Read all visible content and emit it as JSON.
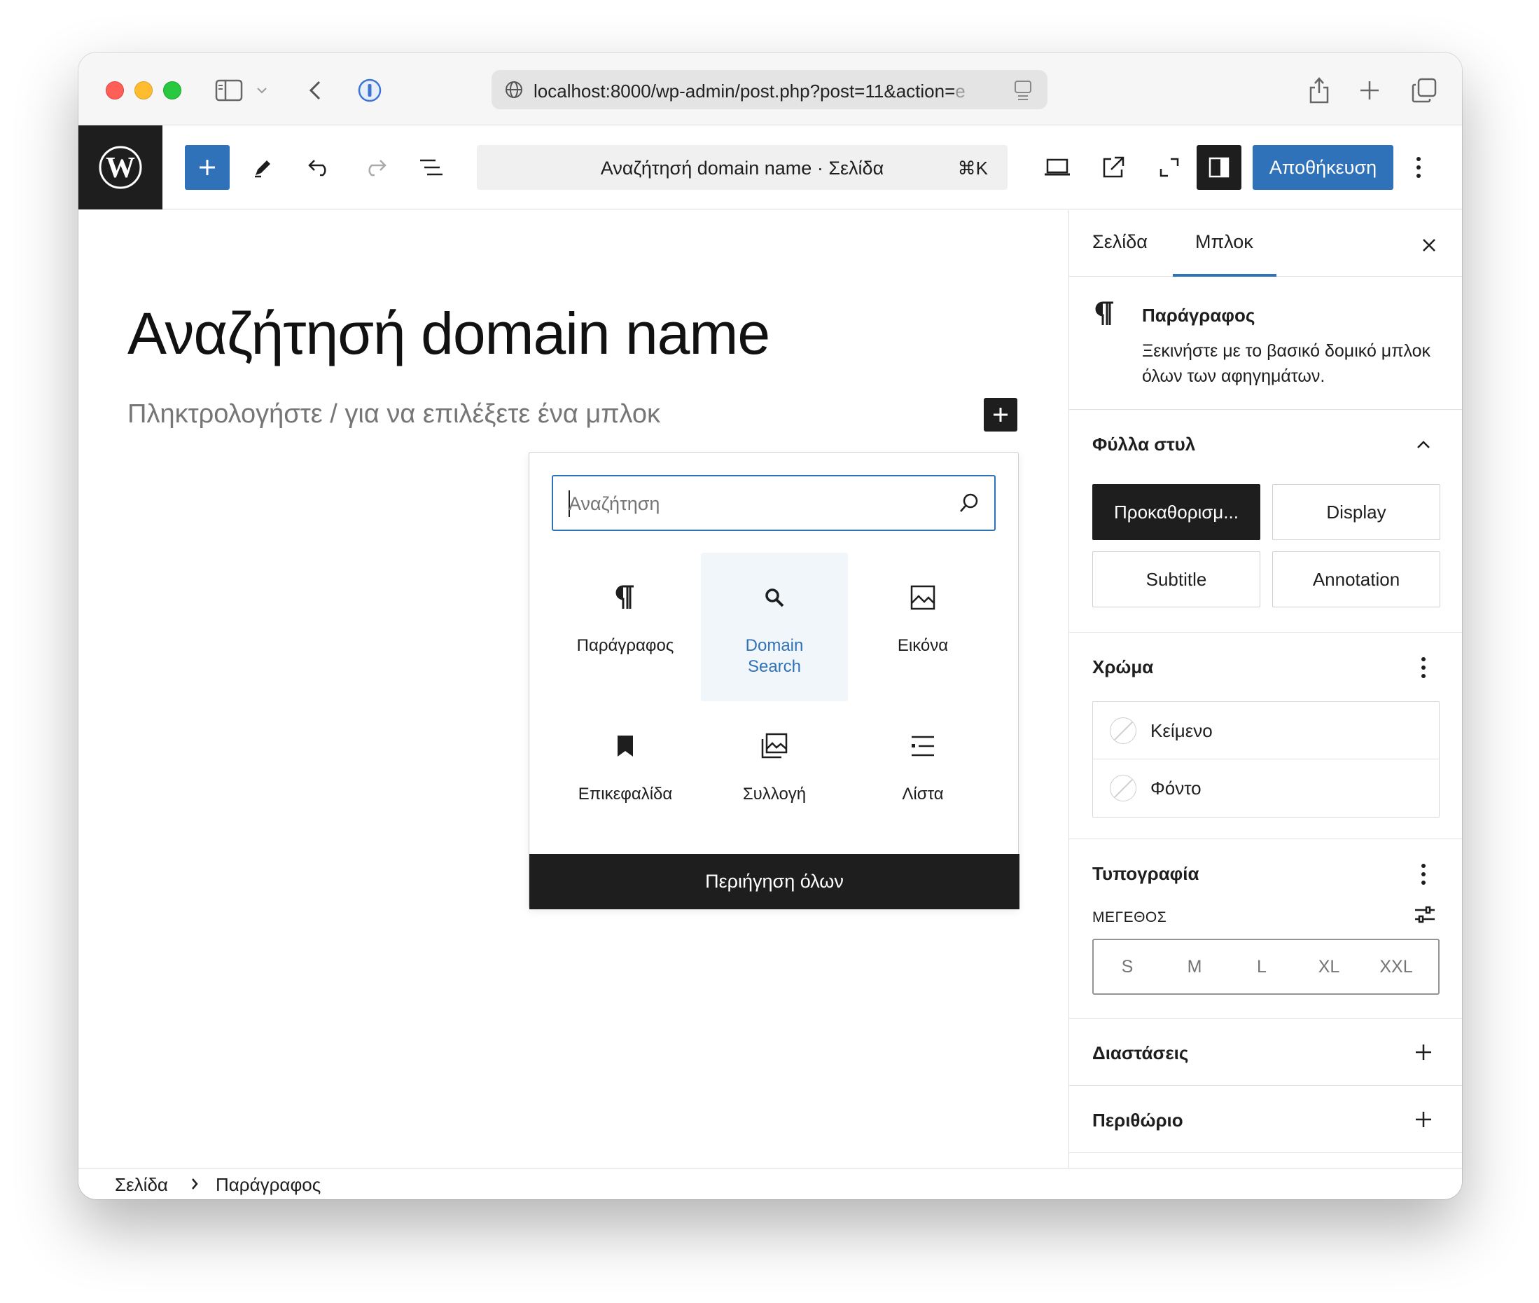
{
  "browser": {
    "url": "localhost:8000/wp-admin/post.php?post=11&action=e",
    "url_visible": "localhost:8000/wp-admin/post.php?post=11&action=",
    "url_faded_tail": "e"
  },
  "toolbar": {
    "document_title": "Αναζήτησή domain name · Σελίδα",
    "shortcut": "⌘K",
    "save_label": "Αποθήκευση"
  },
  "editor": {
    "post_title": "Αναζήτησή domain name",
    "block_placeholder": "Πληκτρολογήστε / για να επιλέξετε ένα μπλοκ"
  },
  "inserter": {
    "search_placeholder": "Αναζήτηση",
    "blocks": [
      {
        "label": "Παράγραφος",
        "icon": "paragraph-icon"
      },
      {
        "label": "Domain Search",
        "icon": "search-icon"
      },
      {
        "label": "Εικόνα",
        "icon": "image-icon"
      },
      {
        "label": "Επικεφαλίδα",
        "icon": "bookmark-icon"
      },
      {
        "label": "Συλλογή",
        "icon": "gallery-icon"
      },
      {
        "label": "Λίστα",
        "icon": "list-icon"
      }
    ],
    "browse_all": "Περιήγηση όλων"
  },
  "sidebar": {
    "tabs": [
      "Σελίδα",
      "Μπλοκ"
    ],
    "active_tab": "Μπλοκ",
    "block_card": {
      "title": "Παράγραφος",
      "description": "Ξεκινήστε με το βασικό δομικό μπλοκ όλων των αφηγημάτων."
    },
    "styles": {
      "title": "Φύλλα στυλ",
      "options": [
        "Προκαθορισμ...",
        "Display",
        "Subtitle",
        "Annotation"
      ],
      "selected": "Προκαθορισμ..."
    },
    "color": {
      "title": "Χρώμα",
      "items": [
        "Κείμενο",
        "Φόντο"
      ]
    },
    "typography": {
      "title": "Τυπογραφία",
      "size_label": "ΜΕΓΕΘΟΣ",
      "sizes": [
        "S",
        "M",
        "L",
        "XL",
        "XXL"
      ]
    },
    "dimensions": {
      "title": "Διαστάσεις"
    },
    "margin": {
      "title": "Περιθώριο"
    }
  },
  "breadcrumb": [
    "Σελίδα",
    "Παράγραφος"
  ],
  "colors": {
    "accent": "#3072b9",
    "dark": "#1e1e1e"
  }
}
